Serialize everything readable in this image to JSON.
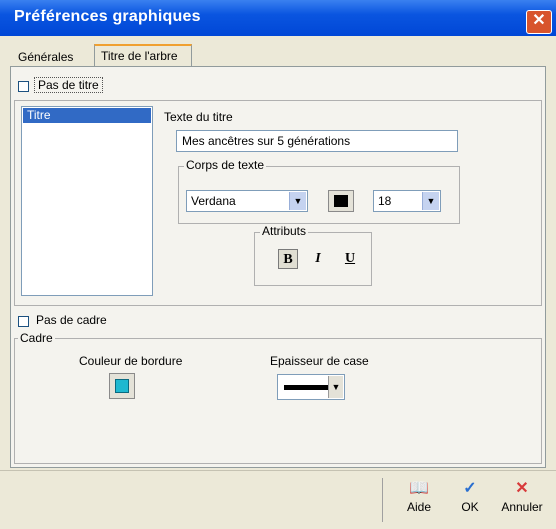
{
  "window": {
    "title": "Préférences graphiques",
    "close_glyph": "✕"
  },
  "tabs": [
    {
      "label": "Générales"
    },
    {
      "label": "Titre de l'arbre"
    }
  ],
  "options": {
    "no_title_label": "Pas de titre",
    "no_frame_label": "Pas de cadre"
  },
  "list": {
    "items": [
      "Titre"
    ]
  },
  "title_text": {
    "label": "Texte du titre",
    "value": "Mes ancêtres sur 5 générations"
  },
  "font_group": {
    "label": "Corps de texte",
    "font_family": "Verdana",
    "font_size": "18",
    "text_color": "#000000",
    "arrow_glyph": "▼"
  },
  "attributes": {
    "label": "Attributs",
    "bold": "B",
    "italic": "I",
    "underline": "U",
    "bold_pressed": true
  },
  "frame": {
    "label": "Cadre",
    "border_color_label": "Couleur de bordure",
    "border_color": "#1fb8d0",
    "thickness_label": "Epaisseur de case"
  },
  "actions": [
    {
      "label": "Aide",
      "icon": "help-book-icon",
      "glyph": "📖"
    },
    {
      "label": "OK",
      "icon": "check-icon",
      "glyph": "✓"
    },
    {
      "label": "Annuler",
      "icon": "x-icon",
      "glyph": "✕"
    }
  ]
}
